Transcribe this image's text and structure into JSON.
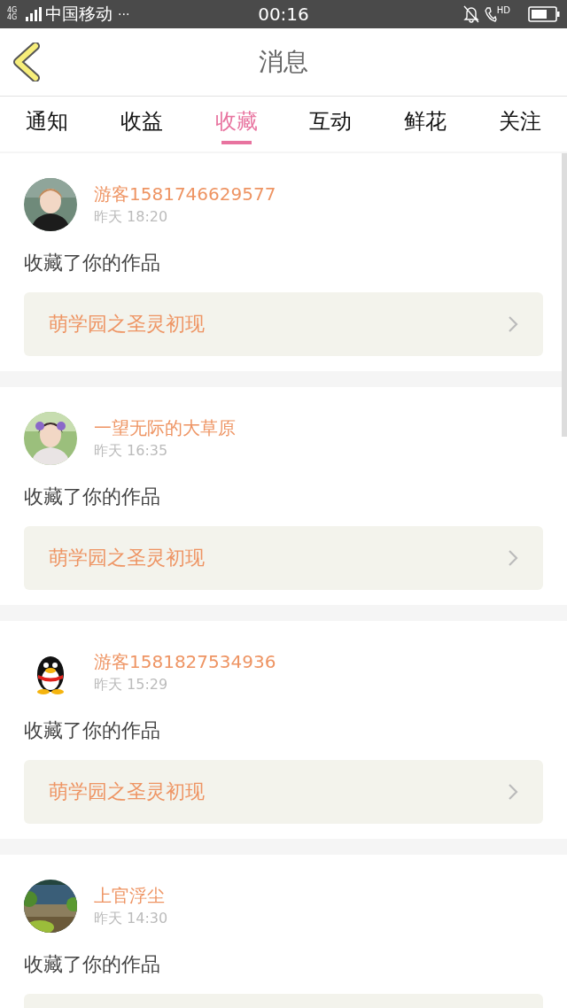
{
  "status_bar": {
    "signal": "4G 4G",
    "carrier": "中国移动",
    "more": "···",
    "time": "00:16",
    "call": "HD"
  },
  "header": {
    "title": "消息"
  },
  "tabs": [
    {
      "label": "通知",
      "selected": false
    },
    {
      "label": "收益",
      "selected": false
    },
    {
      "label": "收藏",
      "selected": true
    },
    {
      "label": "互动",
      "selected": false
    },
    {
      "label": "鲜花",
      "selected": false
    },
    {
      "label": "关注",
      "selected": false
    }
  ],
  "messages": [
    {
      "user": "游客1581746629577",
      "time": "昨天 18:20",
      "action": "收藏了你的作品",
      "work": "萌学园之圣灵初现"
    },
    {
      "user": "一望无际的大草原",
      "time": "昨天 16:35",
      "action": "收藏了你的作品",
      "work": "萌学园之圣灵初现"
    },
    {
      "avatar": {
        "kind": "icon"
      },
      "user": "游客1581827534936",
      "time": "昨天 15:29",
      "action": "收藏了你的作品",
      "work": "萌学园之圣灵初现"
    },
    {
      "user": "上官浮尘",
      "time": "昨天 14:30",
      "action": "收藏了你的作品"
    }
  ]
}
